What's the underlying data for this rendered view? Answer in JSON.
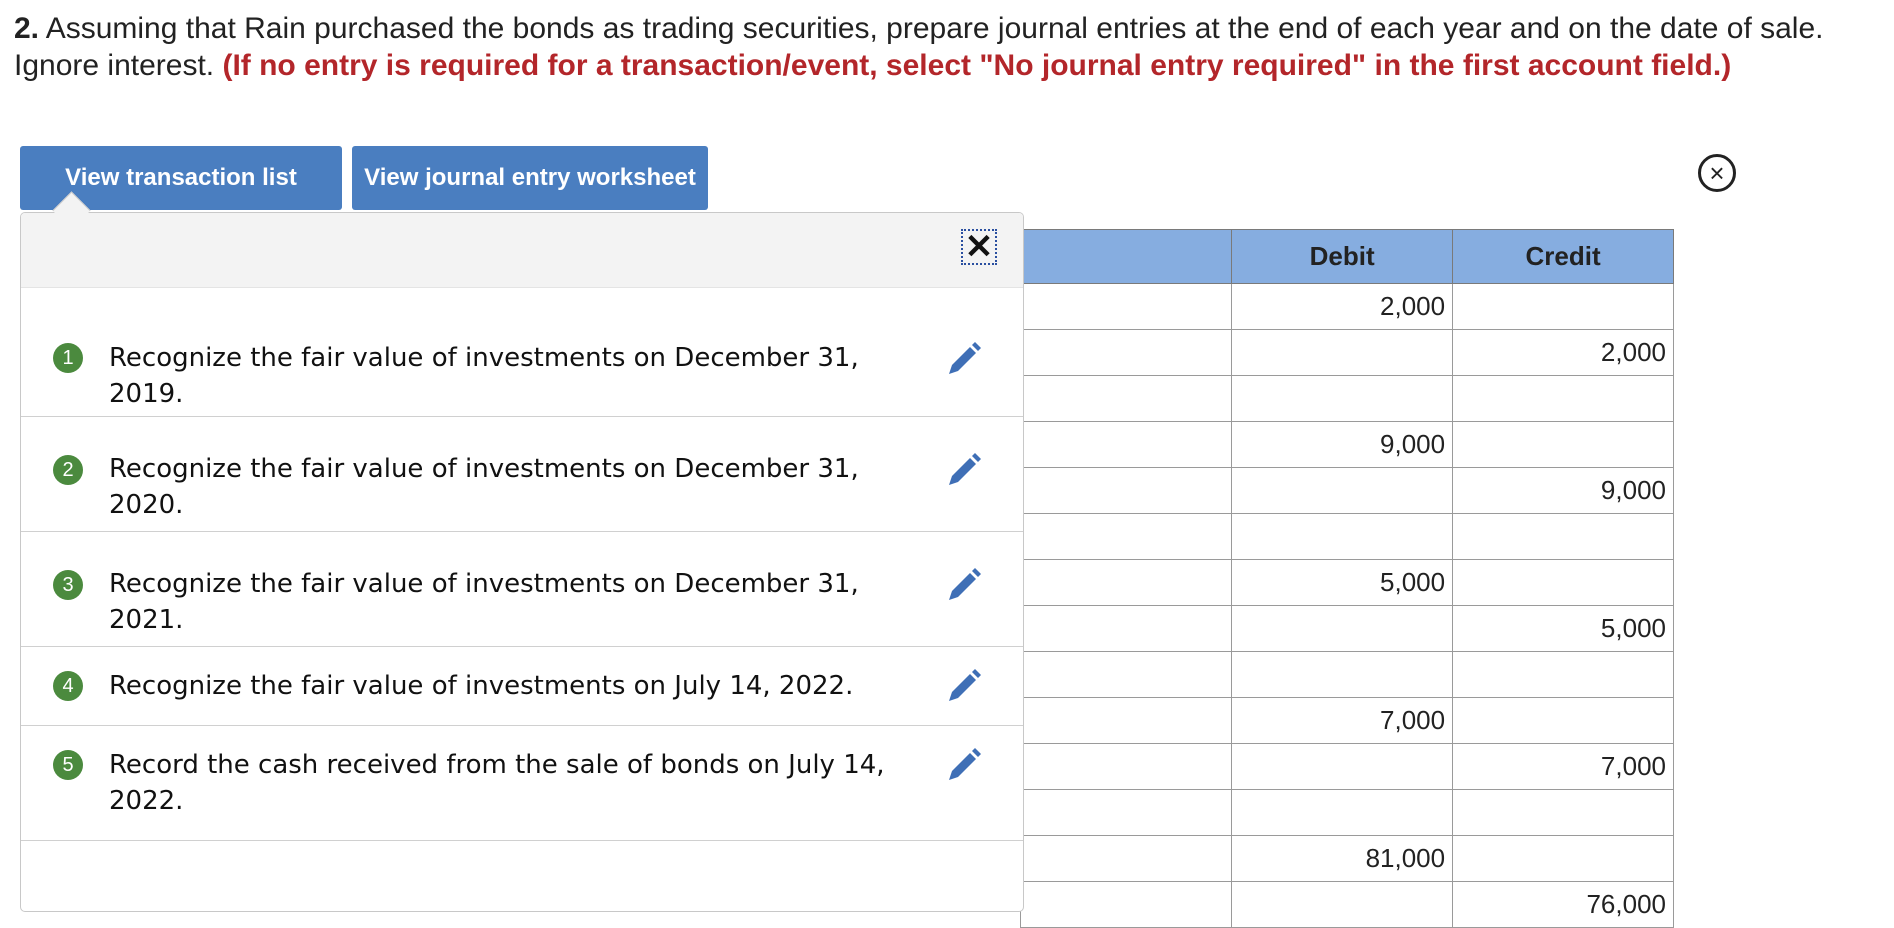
{
  "instructions": {
    "number": "2.",
    "text": " Assuming that Rain purchased the bonds as trading securities, prepare journal entries at the end of each year and on the date of sale. Ignore interest. ",
    "note": "(If no entry is required for a transaction/event, select \"No journal entry required\" in the first account field.)"
  },
  "tabs": {
    "transaction_list": "View transaction list",
    "journal_worksheet": "View journal entry worksheet"
  },
  "close_symbol": "×",
  "popup": {
    "close_symbol": "✕",
    "transactions": [
      {
        "num": "1",
        "text": "Recognize the fair value of investments on December 31, 2019."
      },
      {
        "num": "2",
        "text": "Recognize the fair value of investments on December 31, 2020."
      },
      {
        "num": "3",
        "text": "Recognize the fair value of investments on December 31, 2021."
      },
      {
        "num": "4",
        "text": "Recognize the fair value of investments on July 14, 2022."
      },
      {
        "num": "5",
        "text": "Record the cash received from the sale of bonds on July 14, 2022."
      }
    ]
  },
  "journal": {
    "headers": {
      "account": "",
      "debit": "Debit",
      "credit": "Credit"
    },
    "rows": [
      {
        "debit": "2,000",
        "credit": ""
      },
      {
        "debit": "",
        "credit": "2,000"
      },
      {
        "debit": "",
        "credit": ""
      },
      {
        "debit": "9,000",
        "credit": ""
      },
      {
        "debit": "",
        "credit": "9,000"
      },
      {
        "debit": "",
        "credit": ""
      },
      {
        "debit": "5,000",
        "credit": ""
      },
      {
        "debit": "",
        "credit": "5,000"
      },
      {
        "debit": "",
        "credit": ""
      },
      {
        "debit": "7,000",
        "credit": ""
      },
      {
        "debit": "",
        "credit": "7,000"
      },
      {
        "debit": "",
        "credit": ""
      },
      {
        "debit": "81,000",
        "credit": ""
      },
      {
        "debit": "",
        "credit": "76,000"
      }
    ]
  },
  "colors": {
    "tab_blue": "#4a7ec0",
    "header_blue": "#86ade0",
    "note_red": "#b3262a",
    "badge_green": "#4b8a3e",
    "edit_icon_blue": "#3f6fb6"
  }
}
